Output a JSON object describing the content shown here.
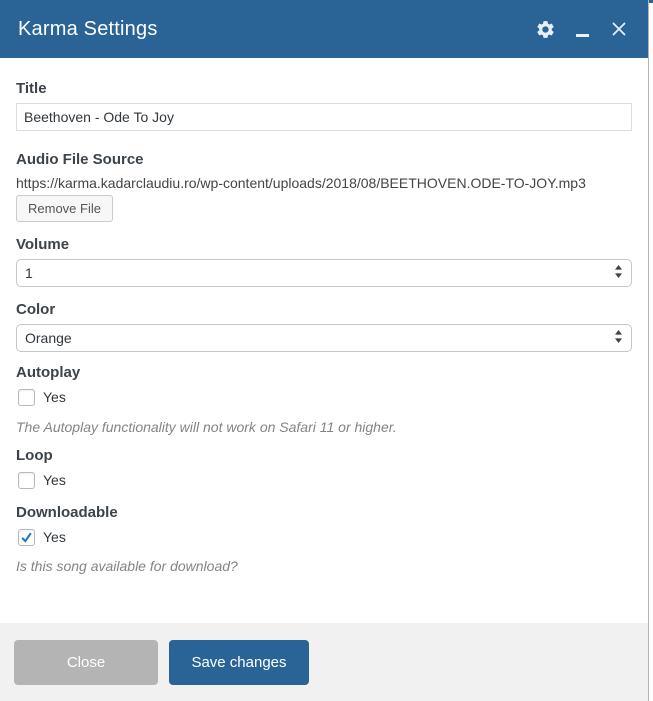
{
  "header": {
    "title": "Karma Settings"
  },
  "form": {
    "title": {
      "label": "Title",
      "value": "Beethoven - Ode To Joy"
    },
    "audio": {
      "label": "Audio File Source",
      "url": "https://karma.kadarclaudiu.ro/wp-content/uploads/2018/08/BEETHOVEN.ODE-TO-JOY.mp3",
      "remove_button": "Remove File"
    },
    "volume": {
      "label": "Volume",
      "selected": "1"
    },
    "color": {
      "label": "Color",
      "selected": "Orange"
    },
    "autoplay": {
      "label": "Autoplay",
      "option": "Yes",
      "checked": false,
      "note": "The Autoplay functionality will not work on Safari 11 or higher."
    },
    "loop": {
      "label": "Loop",
      "option": "Yes",
      "checked": false
    },
    "downloadable": {
      "label": "Downloadable",
      "option": "Yes",
      "checked": true,
      "note": "Is this song available for download?"
    }
  },
  "footer": {
    "close_button": "Close",
    "save_button": "Save changes"
  },
  "colors": {
    "header_bg": "#2a6496",
    "primary_button_bg": "#2a6496",
    "close_button_bg": "#b4b4b4",
    "checkmark": "#1e73be"
  }
}
